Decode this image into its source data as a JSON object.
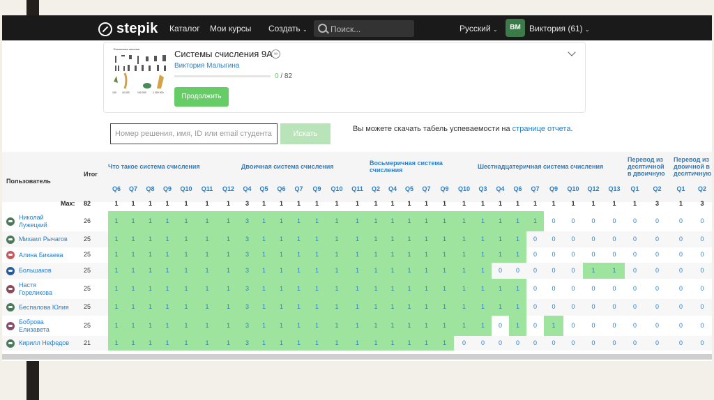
{
  "nav": {
    "logo": "stepik",
    "catalog": "Каталог",
    "my_courses": "Мои курсы",
    "create": "Создать",
    "search_placeholder": "Поиск...",
    "language": "Русский",
    "avatar_initials": "ВМ",
    "user": "Виктория (61)"
  },
  "course": {
    "thumb_title": "Египетская система",
    "thumb_numbers": [
      "1",
      "10",
      "100",
      "1000",
      "10 000",
      "100 000",
      "1 000 000"
    ],
    "title": "Системы счисления 9А",
    "author": "Виктория Малыгина",
    "progress_done": "0",
    "progress_total": "/ 82",
    "progress_fraction": 0.0,
    "continue_button": "Продолжить"
  },
  "search": {
    "placeholder": "Номер решения, имя, ID или email студента",
    "button": "Искать",
    "download_text": "Вы можете скачать табель успеваемости на",
    "download_link": "странице отчета",
    "download_dot": "."
  },
  "table": {
    "user_header": "Пользователь",
    "total_header": "Итог",
    "max_label": "Max:",
    "max_total": "82",
    "groups": [
      {
        "title": "Что такое система счисления",
        "lines": [
          "Что такое система счисления"
        ]
      },
      {
        "title": "Двоичная система счисления",
        "lines": [
          "Двоичная система счисления"
        ]
      },
      {
        "title": "Восьмеричная система счисления",
        "lines": [
          "Восьмеричная система",
          "счисления"
        ]
      },
      {
        "title": "Шестнадцатеричная система счисления",
        "lines": [
          "Шестнадцатеричная система счисления"
        ]
      },
      {
        "title": "Перевод из десятичной в двоичную",
        "lines": [
          "Перевод из",
          "десятичной",
          "в двоичную"
        ]
      },
      {
        "title": "Перевод из двоичной в десятичную",
        "lines": [
          "Перевод из",
          "двоичной в",
          "десятичную"
        ]
      }
    ],
    "questions": [
      "Q6",
      "Q7",
      "Q8",
      "Q9",
      "Q10",
      "Q11",
      "Q12",
      "Q4",
      "Q5",
      "Q6",
      "Q7",
      "Q9",
      "Q10",
      "Q11",
      "Q2",
      "Q4",
      "Q5",
      "Q7",
      "Q9",
      "Q10",
      "Q3",
      "Q4",
      "Q6",
      "Q7",
      "Q9",
      "Q10",
      "Q12",
      "Q13",
      "Q1",
      "Q2",
      "Q1",
      "Q2"
    ],
    "max_values": [
      "1",
      "1",
      "1",
      "1",
      "1",
      "1",
      "1",
      "3",
      "1",
      "1",
      "1",
      "1",
      "1",
      "1",
      "1",
      "1",
      "1",
      "1",
      "1",
      "1",
      "1",
      "1",
      "1",
      "1",
      "1",
      "1",
      "1",
      "1",
      "1",
      "3",
      "1",
      "3"
    ],
    "rows": [
      {
        "name": "Николай Лужецкий",
        "name_lines": [
          "Николай",
          "Лужецкий"
        ],
        "total": "26",
        "avatar_color": "#4a7a5a",
        "scores": [
          "1",
          "1",
          "1",
          "1",
          "1",
          "1",
          "1",
          "3",
          "1",
          "1",
          "1",
          "1",
          "1",
          "1",
          "1",
          "1",
          "1",
          "1",
          "1",
          "1",
          "1",
          "1",
          "1",
          "1",
          "0",
          "0",
          "0",
          "0",
          "0",
          "0",
          "0",
          "0"
        ],
        "solved": [
          1,
          1,
          1,
          1,
          1,
          1,
          1,
          1,
          1,
          1,
          1,
          1,
          1,
          1,
          1,
          1,
          1,
          1,
          1,
          1,
          1,
          1,
          1,
          1,
          0,
          0,
          0,
          0,
          0,
          0,
          0,
          0
        ]
      },
      {
        "name": "Михаил Рычагов",
        "name_lines": [
          "Михаил Рычагов"
        ],
        "total": "25",
        "avatar_color": "#4a7a5a",
        "scores": [
          "1",
          "1",
          "1",
          "1",
          "1",
          "1",
          "1",
          "3",
          "1",
          "1",
          "1",
          "1",
          "1",
          "1",
          "1",
          "1",
          "1",
          "1",
          "1",
          "1",
          "1",
          "1",
          "1",
          "0",
          "0",
          "0",
          "0",
          "0",
          "0",
          "0",
          "0",
          "0"
        ],
        "solved": [
          1,
          1,
          1,
          1,
          1,
          1,
          1,
          1,
          1,
          1,
          1,
          1,
          1,
          1,
          1,
          1,
          1,
          1,
          1,
          1,
          1,
          1,
          1,
          0,
          0,
          0,
          0,
          0,
          0,
          0,
          0,
          0
        ]
      },
      {
        "name": "Алина Бикаева",
        "name_lines": [
          "Алина Бикаева"
        ],
        "total": "25",
        "avatar_color": "#c85a5a",
        "scores": [
          "1",
          "1",
          "1",
          "1",
          "1",
          "1",
          "1",
          "3",
          "1",
          "1",
          "1",
          "1",
          "1",
          "1",
          "1",
          "1",
          "1",
          "1",
          "1",
          "1",
          "1",
          "1",
          "1",
          "0",
          "0",
          "0",
          "0",
          "0",
          "0",
          "0",
          "0",
          "0"
        ],
        "solved": [
          1,
          1,
          1,
          1,
          1,
          1,
          1,
          1,
          1,
          1,
          1,
          1,
          1,
          1,
          1,
          1,
          1,
          1,
          1,
          1,
          1,
          1,
          1,
          0,
          0,
          0,
          0,
          0,
          0,
          0,
          0,
          0
        ]
      },
      {
        "name": "Большаков",
        "name_lines": [
          "Большаков"
        ],
        "total": "25",
        "avatar_color": "#2a5a9a",
        "scores": [
          "1",
          "1",
          "1",
          "1",
          "1",
          "1",
          "1",
          "3",
          "1",
          "1",
          "1",
          "1",
          "1",
          "1",
          "1",
          "1",
          "1",
          "1",
          "1",
          "1",
          "1",
          "0",
          "0",
          "0",
          "0",
          "0",
          "1",
          "1",
          "0",
          "0",
          "0",
          "0"
        ],
        "solved": [
          1,
          1,
          1,
          1,
          1,
          1,
          1,
          1,
          1,
          1,
          1,
          1,
          1,
          1,
          1,
          1,
          1,
          1,
          1,
          1,
          1,
          0,
          0,
          0,
          0,
          0,
          1,
          1,
          0,
          0,
          0,
          0
        ]
      },
      {
        "name": "Настя Гореликова",
        "name_lines": [
          "Настя",
          "Гореликова"
        ],
        "total": "25",
        "avatar_color": "#8a4a5a",
        "scores": [
          "1",
          "1",
          "1",
          "1",
          "1",
          "1",
          "1",
          "3",
          "1",
          "1",
          "1",
          "1",
          "1",
          "1",
          "1",
          "1",
          "1",
          "1",
          "1",
          "1",
          "1",
          "1",
          "1",
          "0",
          "0",
          "0",
          "0",
          "0",
          "0",
          "0",
          "0",
          "0"
        ],
        "solved": [
          1,
          1,
          1,
          1,
          1,
          1,
          1,
          1,
          1,
          1,
          1,
          1,
          1,
          1,
          1,
          1,
          1,
          1,
          1,
          1,
          1,
          1,
          1,
          0,
          0,
          0,
          0,
          0,
          0,
          0,
          0,
          0
        ]
      },
      {
        "name": "Беспалова Юлия",
        "name_lines": [
          "Беспалова Юлия"
        ],
        "total": "25",
        "avatar_color": "#4a7a5a",
        "scores": [
          "1",
          "1",
          "1",
          "1",
          "1",
          "1",
          "1",
          "3",
          "1",
          "1",
          "1",
          "1",
          "1",
          "1",
          "1",
          "1",
          "1",
          "1",
          "1",
          "1",
          "1",
          "1",
          "1",
          "0",
          "0",
          "0",
          "0",
          "0",
          "0",
          "0",
          "0",
          "0"
        ],
        "solved": [
          1,
          1,
          1,
          1,
          1,
          1,
          1,
          1,
          1,
          1,
          1,
          1,
          1,
          1,
          1,
          1,
          1,
          1,
          1,
          1,
          1,
          1,
          1,
          0,
          0,
          0,
          0,
          0,
          0,
          0,
          0,
          0
        ]
      },
      {
        "name": "Боброва Елизавета",
        "name_lines": [
          "Боброва",
          "Елизавета"
        ],
        "total": "25",
        "avatar_color": "#8a4a6a",
        "scores": [
          "1",
          "1",
          "1",
          "1",
          "1",
          "1",
          "1",
          "3",
          "1",
          "1",
          "1",
          "1",
          "1",
          "1",
          "1",
          "1",
          "1",
          "1",
          "1",
          "1",
          "1",
          "0",
          "1",
          "0",
          "1",
          "0",
          "0",
          "0",
          "0",
          "0",
          "0",
          "0"
        ],
        "solved": [
          1,
          1,
          1,
          1,
          1,
          1,
          1,
          1,
          1,
          1,
          1,
          1,
          1,
          1,
          1,
          1,
          1,
          1,
          1,
          1,
          1,
          0,
          1,
          0,
          1,
          0,
          0,
          0,
          0,
          0,
          0,
          0
        ]
      },
      {
        "name": "Кирилл Нефедов",
        "name_lines": [
          "Кирилл Нефедов"
        ],
        "total": "21",
        "avatar_color": "#4a7a5a",
        "scores": [
          "1",
          "1",
          "1",
          "1",
          "1",
          "1",
          "1",
          "3",
          "1",
          "1",
          "1",
          "1",
          "1",
          "1",
          "1",
          "1",
          "1",
          "1",
          "1",
          "0",
          "0",
          "0",
          "0",
          "0",
          "0",
          "0",
          "0",
          "0",
          "0",
          "0",
          "0",
          "0"
        ],
        "solved": [
          1,
          1,
          1,
          1,
          1,
          1,
          1,
          1,
          1,
          1,
          1,
          1,
          1,
          1,
          1,
          1,
          1,
          1,
          1,
          0,
          0,
          0,
          0,
          0,
          0,
          0,
          0,
          0,
          0,
          0,
          0,
          0
        ]
      }
    ]
  },
  "colors": {
    "solved": "#9ee39e",
    "link": "#2a7ec6",
    "brand_green": "#66cc66"
  }
}
